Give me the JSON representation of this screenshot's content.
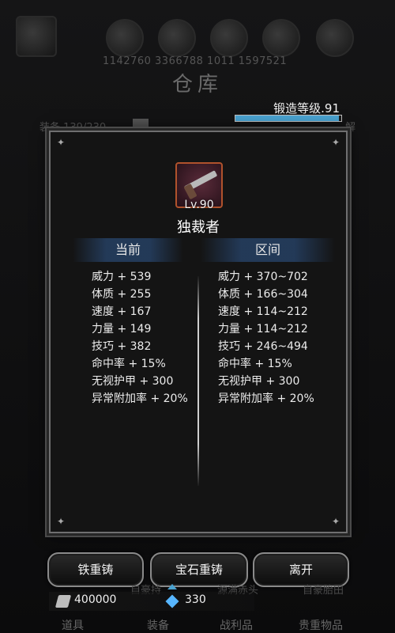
{
  "background": {
    "title": "仓库",
    "info_line": "1142760  3366788  1011 1597521",
    "equip_count": "装备   139/230",
    "unlock": "解"
  },
  "forge": {
    "label": "锻造等级.91",
    "progress": 0.98
  },
  "item": {
    "level": "Lv.90",
    "name": "独裁者"
  },
  "columns": {
    "current": "当前",
    "range": "区间"
  },
  "stats_current": [
    "威力 + 539",
    "体质 + 255",
    "速度 + 167",
    "力量 + 149",
    "技巧 + 382",
    "命中率 + 15%",
    "无视护甲 + 300",
    "异常附加率 + 20%"
  ],
  "stats_range": [
    "威力 + 370~702",
    "体质 + 166~304",
    "速度 + 114~212",
    "力量 + 114~212",
    "技巧 + 246~494",
    "命中率 + 15%",
    "无视护甲 + 300",
    "异常附加率 + 20%"
  ],
  "buttons": {
    "iron_reforge": "铁重铸",
    "gem_reforge": "宝石重铸",
    "leave": "离开"
  },
  "currency": {
    "silver": "400000",
    "gem": "330"
  },
  "bg_hints": [
    "自豪持",
    "源满赤头",
    "自豪胎田"
  ],
  "tabs": [
    "道具",
    "装备",
    "战利品",
    "贵重物品"
  ],
  "colors": {
    "accent_blue": "#4aa3d1",
    "item_border": "#b0522c"
  }
}
